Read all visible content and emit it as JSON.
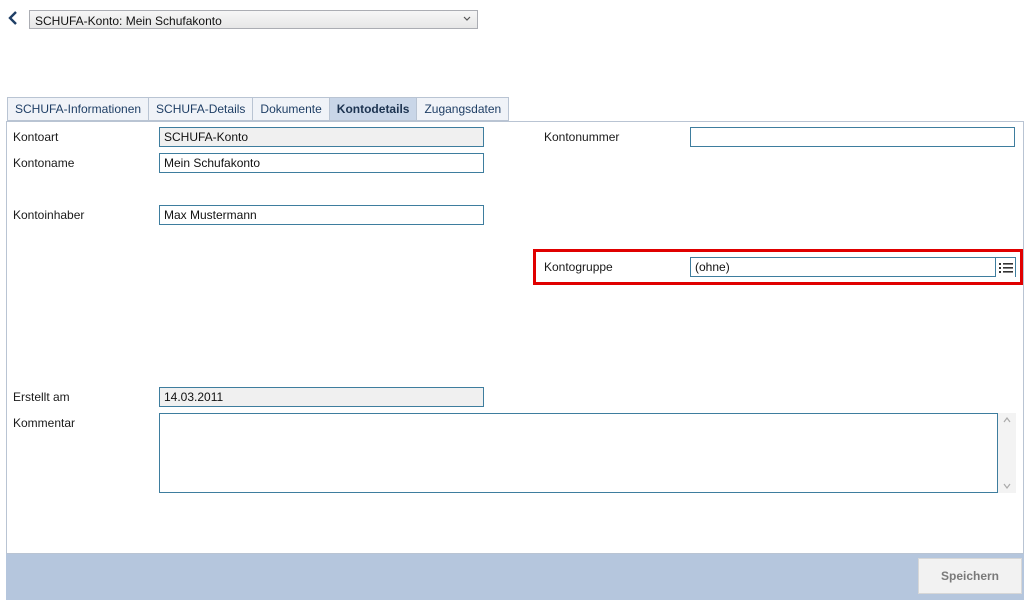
{
  "header": {
    "account_select_value": "SCHUFA-Konto: Mein Schufakonto"
  },
  "tabs": [
    {
      "label": "SCHUFA-Informationen",
      "active": false
    },
    {
      "label": "SCHUFA-Details",
      "active": false
    },
    {
      "label": "Dokumente",
      "active": false
    },
    {
      "label": "Kontodetails",
      "active": true
    },
    {
      "label": "Zugangsdaten",
      "active": false
    }
  ],
  "form": {
    "kontoart": {
      "label": "Kontoart",
      "value": "SCHUFA-Konto"
    },
    "kontoname": {
      "label": "Kontoname",
      "value": "Mein Schufakonto"
    },
    "kontoinhaber": {
      "label": "Kontoinhaber",
      "value": "Max Mustermann"
    },
    "kontonummer": {
      "label": "Kontonummer",
      "value": ""
    },
    "kontogruppe": {
      "label": "Kontogruppe",
      "value": "(ohne)"
    },
    "erstellt_am": {
      "label": "Erstellt am",
      "value": "14.03.2011"
    },
    "kommentar": {
      "label": "Kommentar",
      "value": ""
    }
  },
  "footer": {
    "save_label": "Speichern"
  },
  "colors": {
    "highlight": "#e00000",
    "footer_bar": "#b5c6dd",
    "active_tab": "#c9d6e8",
    "field_border": "#3e7d9e"
  },
  "icons": {
    "back": "chevron-left-icon",
    "dropdown": "chevron-down-icon",
    "list": "list-icon",
    "scroll_up": "chevron-up-icon",
    "scroll_down": "chevron-down-icon"
  }
}
